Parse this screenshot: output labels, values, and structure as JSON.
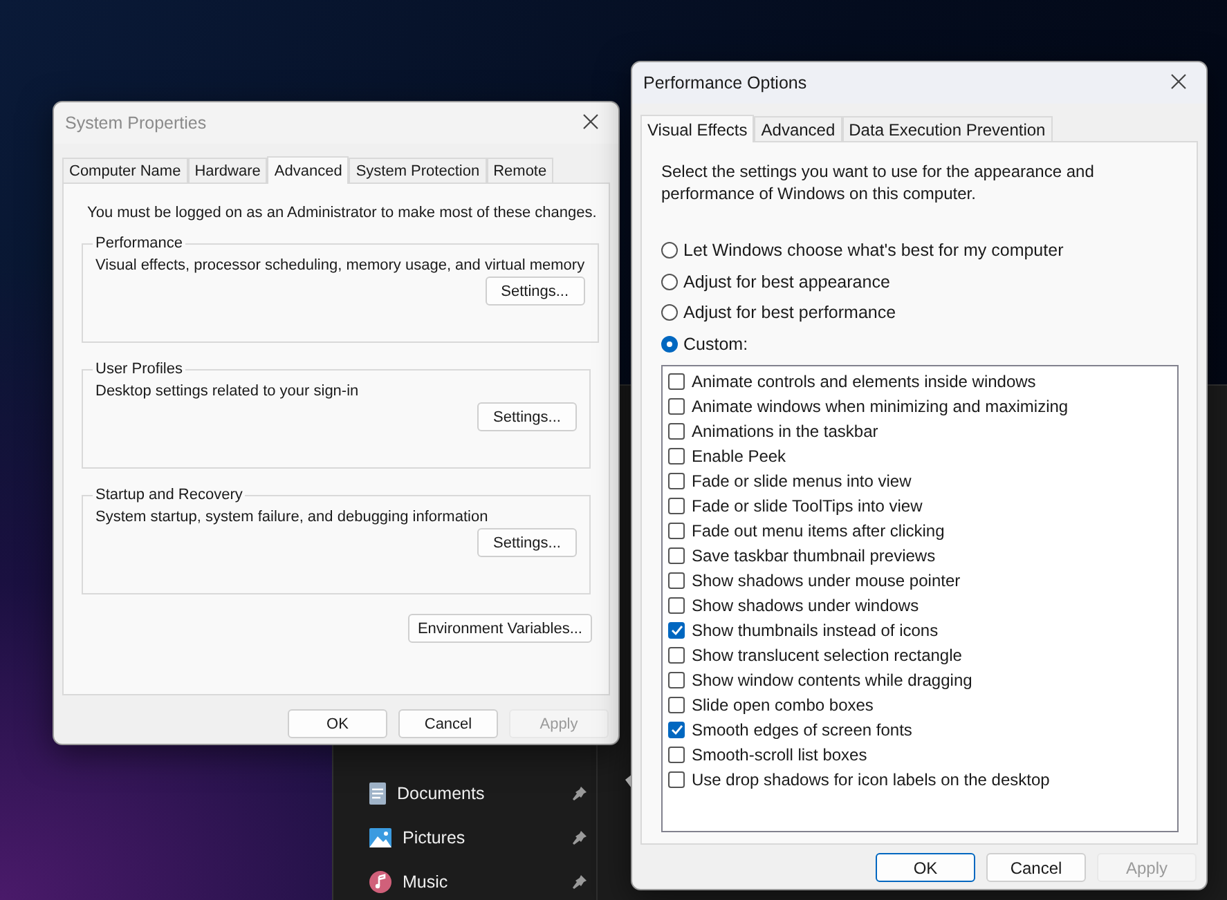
{
  "background_window": {
    "nav_items": [
      {
        "label": "Documents",
        "kind": "documents"
      },
      {
        "label": "Pictures",
        "kind": "pictures"
      },
      {
        "label": "Music",
        "kind": "music"
      }
    ]
  },
  "system_properties": {
    "title": "System Properties",
    "tabs": [
      {
        "label": "Computer Name",
        "selected": false
      },
      {
        "label": "Hardware",
        "selected": false
      },
      {
        "label": "Advanced",
        "selected": true
      },
      {
        "label": "System Protection",
        "selected": false
      },
      {
        "label": "Remote",
        "selected": false
      }
    ],
    "notice": "You must be logged on as an Administrator to make most of these changes.",
    "groups": [
      {
        "title": "Performance",
        "description": "Visual effects, processor scheduling, memory usage, and virtual memory",
        "button": "Settings..."
      },
      {
        "title": "User Profiles",
        "description": "Desktop settings related to your sign-in",
        "button": "Settings..."
      },
      {
        "title": "Startup and Recovery",
        "description": "System startup, system failure, and debugging information",
        "button": "Settings..."
      }
    ],
    "env_button": "Environment Variables...",
    "buttons": [
      {
        "label": "OK",
        "disabled": false,
        "focused": false
      },
      {
        "label": "Cancel",
        "disabled": false,
        "focused": false
      },
      {
        "label": "Apply",
        "disabled": true,
        "focused": false
      }
    ]
  },
  "performance_options": {
    "title": "Performance Options",
    "tabs": [
      {
        "label": "Visual Effects",
        "selected": true
      },
      {
        "label": "Advanced",
        "selected": false
      },
      {
        "label": "Data Execution Prevention",
        "selected": false
      }
    ],
    "intro": "Select the settings you want to use for the appearance and performance of Windows on this computer.",
    "radios": [
      {
        "label": "Let Windows choose what's best for my computer",
        "selected": false
      },
      {
        "label": "Adjust for best appearance",
        "selected": false
      },
      {
        "label": "Adjust for best performance",
        "selected": false
      },
      {
        "label": "Custom:",
        "selected": true
      }
    ],
    "effects": [
      {
        "label": "Animate controls and elements inside windows",
        "checked": false
      },
      {
        "label": "Animate windows when minimizing and maximizing",
        "checked": false
      },
      {
        "label": "Animations in the taskbar",
        "checked": false
      },
      {
        "label": "Enable Peek",
        "checked": false
      },
      {
        "label": "Fade or slide menus into view",
        "checked": false
      },
      {
        "label": "Fade or slide ToolTips into view",
        "checked": false
      },
      {
        "label": "Fade out menu items after clicking",
        "checked": false
      },
      {
        "label": "Save taskbar thumbnail previews",
        "checked": false
      },
      {
        "label": "Show shadows under mouse pointer",
        "checked": false
      },
      {
        "label": "Show shadows under windows",
        "checked": false
      },
      {
        "label": "Show thumbnails instead of icons",
        "checked": true
      },
      {
        "label": "Show translucent selection rectangle",
        "checked": false
      },
      {
        "label": "Show window contents while dragging",
        "checked": false
      },
      {
        "label": "Slide open combo boxes",
        "checked": false
      },
      {
        "label": "Smooth edges of screen fonts",
        "checked": true
      },
      {
        "label": "Smooth-scroll list boxes",
        "checked": false
      },
      {
        "label": "Use drop shadows for icon labels on the desktop",
        "checked": false
      }
    ],
    "buttons": [
      {
        "label": "OK",
        "disabled": false,
        "focused": true
      },
      {
        "label": "Cancel",
        "disabled": false,
        "focused": false
      },
      {
        "label": "Apply",
        "disabled": true,
        "focused": false
      }
    ]
  }
}
